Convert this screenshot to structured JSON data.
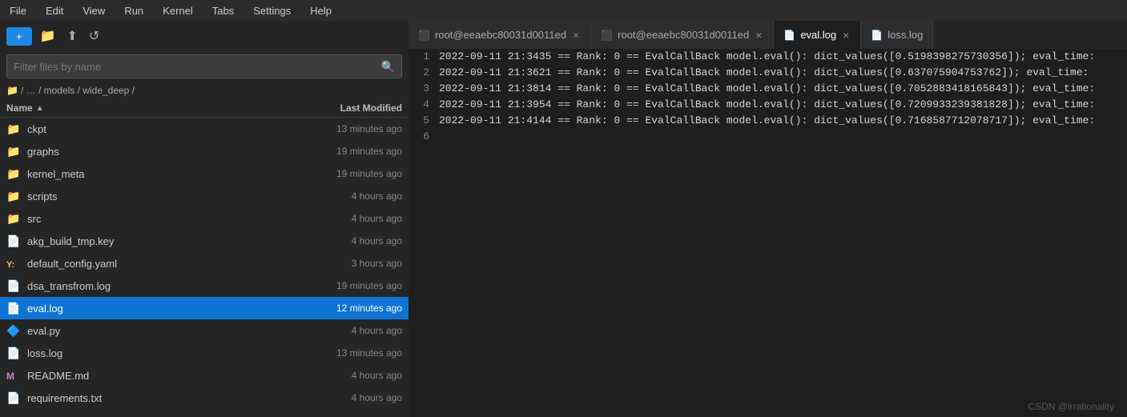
{
  "menubar": {
    "items": [
      "File",
      "Edit",
      "View",
      "Run",
      "Kernel",
      "Tabs",
      "Settings",
      "Help"
    ]
  },
  "toolbar": {
    "new_label": "+",
    "folder_icon": "📁",
    "upload_icon": "⬆",
    "refresh_icon": "↺"
  },
  "search": {
    "placeholder": "Filter files by name"
  },
  "breadcrumb": {
    "text": "/ … / models / wide_deep /"
  },
  "file_list": {
    "col_name": "Name",
    "col_modified": "Last Modified",
    "files": [
      {
        "name": "ckpt",
        "modified": "13 minutes ago",
        "type": "folder",
        "selected": false
      },
      {
        "name": "graphs",
        "modified": "19 minutes ago",
        "type": "folder",
        "selected": false
      },
      {
        "name": "kernel_meta",
        "modified": "19 minutes ago",
        "type": "folder",
        "selected": false
      },
      {
        "name": "scripts",
        "modified": "4 hours ago",
        "type": "folder",
        "selected": false
      },
      {
        "name": "src",
        "modified": "4 hours ago",
        "type": "folder",
        "selected": false
      },
      {
        "name": "akg_build_tmp.key",
        "modified": "4 hours ago",
        "type": "file",
        "selected": false
      },
      {
        "name": "default_config.yaml",
        "modified": "3 hours ago",
        "type": "yaml",
        "selected": false
      },
      {
        "name": "dsa_transfrom.log",
        "modified": "19 minutes ago",
        "type": "file",
        "selected": false
      },
      {
        "name": "eval.log",
        "modified": "12 minutes ago",
        "type": "log",
        "selected": true
      },
      {
        "name": "eval.py",
        "modified": "4 hours ago",
        "type": "py",
        "selected": false
      },
      {
        "name": "loss.log",
        "modified": "13 minutes ago",
        "type": "log",
        "selected": false
      },
      {
        "name": "README.md",
        "modified": "4 hours ago",
        "type": "md",
        "selected": false
      },
      {
        "name": "requirements.txt",
        "modified": "4 hours ago",
        "type": "file",
        "selected": false
      }
    ]
  },
  "tabs": [
    {
      "id": "terminal1",
      "label": "root@eeaebc80031d0011ed",
      "type": "terminal",
      "active": false,
      "closable": true
    },
    {
      "id": "terminal2",
      "label": "root@eeaebc80031d0011ed",
      "type": "terminal",
      "active": false,
      "closable": true
    },
    {
      "id": "evallog",
      "label": "eval.log",
      "type": "log",
      "active": true,
      "closable": true
    },
    {
      "id": "losslog",
      "label": "loss.log",
      "type": "log",
      "active": false,
      "closable": false
    }
  ],
  "editor": {
    "lines": [
      {
        "num": 1,
        "text": "2022-09-11 21:3435 == Rank: 0 == EvalCallBack model.eval(): dict_values([0.5198398275730356]); eval_time:"
      },
      {
        "num": 2,
        "text": "2022-09-11 21:3621 == Rank: 0 == EvalCallBack model.eval(): dict_values([0.637075904753762]); eval_time:"
      },
      {
        "num": 3,
        "text": "2022-09-11 21:3814 == Rank: 0 == EvalCallBack model.eval(): dict_values([0.7052883418165843]); eval_time:"
      },
      {
        "num": 4,
        "text": "2022-09-11 21:3954 == Rank: 0 == EvalCallBack model.eval(): dict_values([0.7209933239381828]); eval_time:"
      },
      {
        "num": 5,
        "text": "2022-09-11 21:4144 == Rank: 0 == EvalCallBack model.eval(): dict_values([0.7168587712078717]); eval_time:"
      },
      {
        "num": 6,
        "text": ""
      }
    ]
  },
  "watermark": {
    "text": "CSDN @irrationality"
  }
}
